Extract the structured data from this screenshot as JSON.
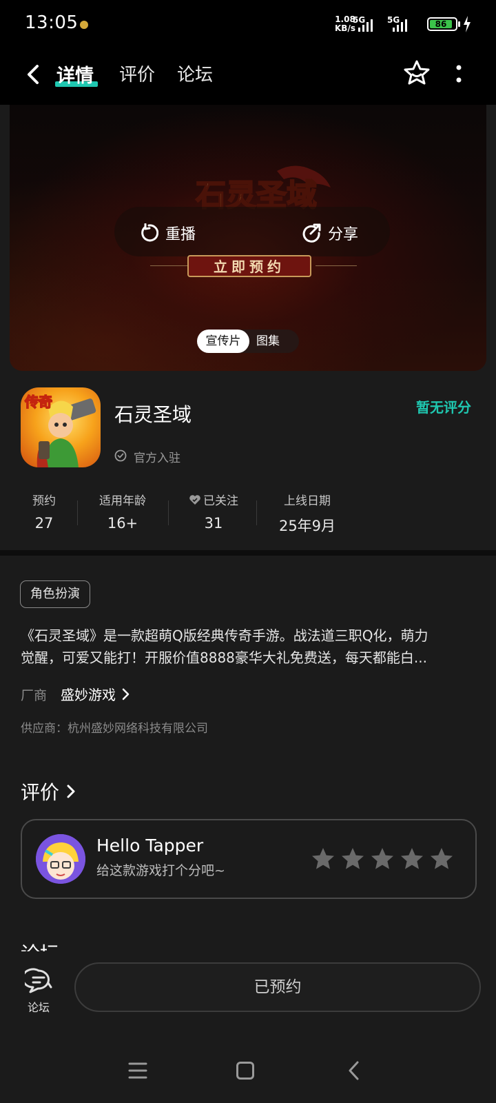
{
  "status_bar": {
    "time": "13:05",
    "net_speed_value": "1.08",
    "net_speed_unit": "KB/s",
    "sim1_label": "5G",
    "sim2_label": "5G",
    "battery_level": "86",
    "battery_color": "#3bc34a"
  },
  "nav": {
    "tabs": [
      {
        "label": "详情",
        "active": true
      },
      {
        "label": "评价",
        "active": false
      },
      {
        "label": "论坛",
        "active": false
      }
    ],
    "accent": "#1fc7b0",
    "icons": [
      "back-arrow-icon",
      "star-add-icon",
      "more-vertical-icon"
    ]
  },
  "banner": {
    "logo_text": "石灵圣域",
    "replay_label": "重播",
    "share_label": "分享",
    "preorder_label": "立即预约",
    "media_tabs": [
      {
        "label": "宣传片",
        "active": true
      },
      {
        "label": "图集",
        "active": false
      }
    ]
  },
  "app": {
    "icon_text": "传奇",
    "name": "石灵圣域",
    "verified_label": "官方入驻",
    "rating_status": "暂无评分",
    "stats": [
      {
        "key": "预约",
        "value": "27"
      },
      {
        "key": "适用年龄",
        "value": "16+"
      },
      {
        "key": "已关注",
        "value": "31"
      },
      {
        "key": "上线日期",
        "value": "25年9月"
      }
    ]
  },
  "details": {
    "genre_tag": "角色扮演",
    "description_line1": "《石灵圣域》是一款超萌Q版经典传奇手游。战法道三职Q化，萌力",
    "description_line2": "觉醒，可爱又能打！开服价值8888豪华大礼免费送，每天都能白...",
    "vendor_key": "厂商",
    "vendor_name": "盛妙游戏",
    "supplier": "供应商：杭州盛妙网络科技有限公司"
  },
  "reviews": {
    "heading": "评价",
    "user_name": "Hello Tapper",
    "prompt": "给这款游戏打个分吧~",
    "star_count": 5,
    "rating": 0
  },
  "forum": {
    "heading": "论坛"
  },
  "bottom": {
    "forum_label": "论坛",
    "reserved_label": "已预约"
  }
}
